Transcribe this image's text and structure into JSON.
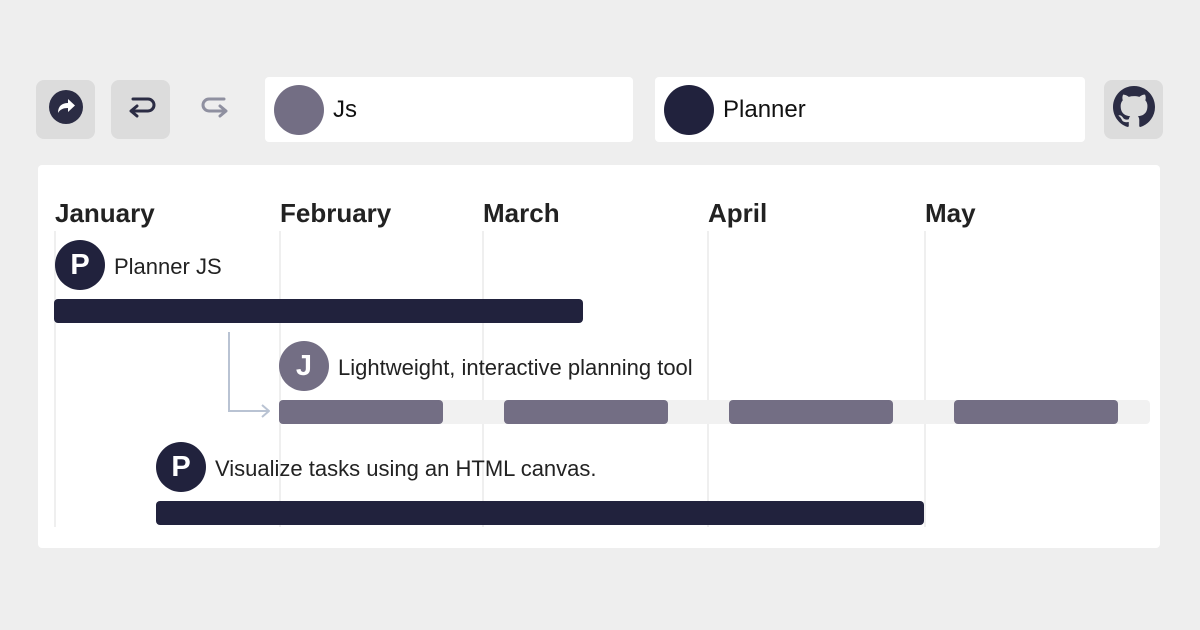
{
  "toolbar": {
    "buttons": [
      {
        "name": "share-button",
        "icon": "share-icon"
      },
      {
        "name": "undo-button",
        "icon": "undo-icon"
      },
      {
        "name": "redo-button",
        "icon": "redo-icon"
      },
      {
        "name": "github-button",
        "icon": "github-icon"
      }
    ],
    "projects": [
      {
        "label": "Js",
        "color": "#736e84"
      },
      {
        "label": "Planner",
        "color": "#21223d"
      }
    ]
  },
  "timeline": {
    "months": [
      "January",
      "February",
      "March",
      "April",
      "May"
    ],
    "tasks": [
      {
        "avatar": "P",
        "label": "Planner JS",
        "color": "#21223d"
      },
      {
        "avatar": "J",
        "label": "Lightweight, interactive planning tool",
        "color": "#736e84"
      },
      {
        "avatar": "P",
        "label": "Visualize tasks using an HTML canvas.",
        "color": "#21223d"
      }
    ]
  },
  "colors": {
    "dark": "#21223d",
    "grey": "#736e84",
    "background": "#eeeeee",
    "panel": "#ffffff"
  }
}
